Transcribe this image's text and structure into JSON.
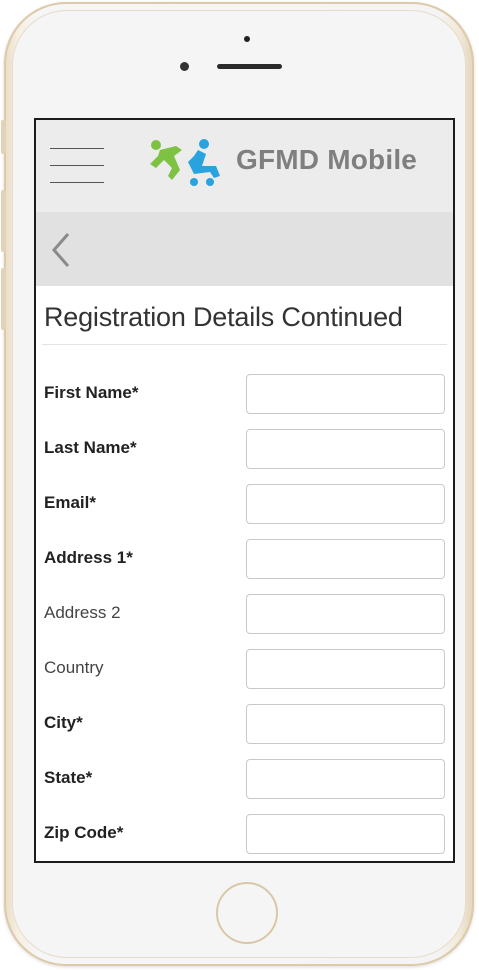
{
  "app": {
    "title": "GFMD Mobile",
    "brand_colors": {
      "logo_green": "#7dc242",
      "logo_blue": "#29a3dd",
      "title_gray": "#7f7f7f"
    }
  },
  "icons": {
    "menu": "hamburger-icon",
    "logo": "gfmd-logo-icon",
    "back": "chevron-left-icon"
  },
  "page": {
    "title": "Registration Details Continued"
  },
  "form": {
    "fields": [
      {
        "label": "First Name*",
        "value": "",
        "required": true
      },
      {
        "label": "Last Name*",
        "value": "",
        "required": true
      },
      {
        "label": "Email*",
        "value": "",
        "required": true
      },
      {
        "label": "Address 1*",
        "value": "",
        "required": true
      },
      {
        "label": "Address 2",
        "value": "",
        "required": false
      },
      {
        "label": "Country",
        "value": "",
        "required": false
      },
      {
        "label": "City*",
        "value": "",
        "required": true
      },
      {
        "label": "State*",
        "value": "",
        "required": true
      },
      {
        "label": "Zip Code*",
        "value": "",
        "required": true
      }
    ]
  }
}
